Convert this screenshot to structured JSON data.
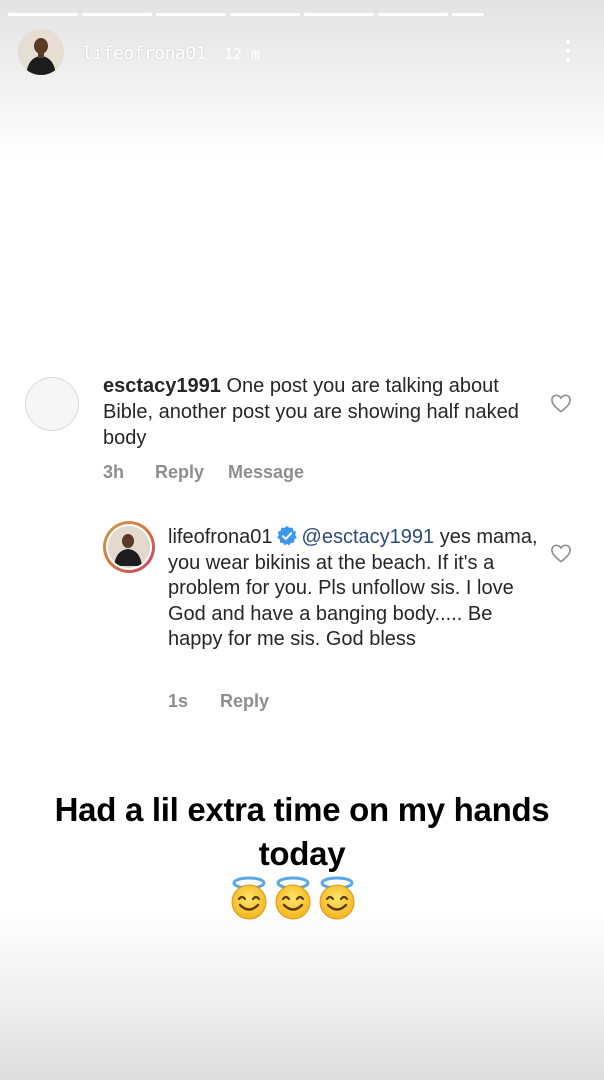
{
  "story": {
    "username": "lifeofrona01",
    "time": "12 m",
    "segments": 8,
    "progress_segments_complete": 6.45
  },
  "comment": {
    "username": "esctacy1991",
    "text": "One post you are talking about Bible, another post you are showing half naked body",
    "time": "3h",
    "reply_label": "Reply",
    "message_label": "Message"
  },
  "reply": {
    "username": "lifeofrona01",
    "mention": "@esctacy1991",
    "text": "yes mama, you wear bikinis at the beach. If it's a problem for you. Pls unfollow sis.  I love God and have a banging body..... Be happy for me sis. God bless",
    "time": "1s",
    "reply_label": "Reply"
  },
  "caption": {
    "text": "Had a lil extra time on my hands today",
    "emoji": "smiling-face-with-halo",
    "emoji_count": 3
  },
  "colors": {
    "text": "#262626",
    "meta": "#8e8e8e",
    "verified": "#3897f0",
    "mention": "#2e4a7a"
  }
}
